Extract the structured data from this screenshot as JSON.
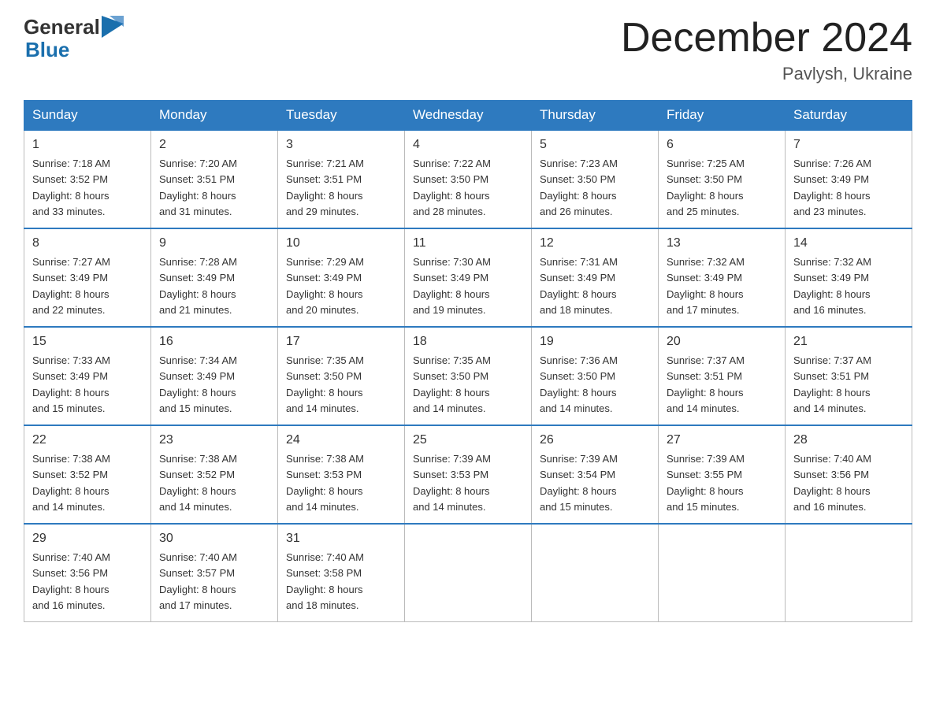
{
  "header": {
    "logo": {
      "general": "General",
      "blue": "Blue"
    },
    "title": "December 2024",
    "location": "Pavlysh, Ukraine"
  },
  "weekdays": [
    "Sunday",
    "Monday",
    "Tuesday",
    "Wednesday",
    "Thursday",
    "Friday",
    "Saturday"
  ],
  "weeks": [
    [
      {
        "day": "1",
        "sunrise": "7:18 AM",
        "sunset": "3:52 PM",
        "daylight": "8 hours and 33 minutes."
      },
      {
        "day": "2",
        "sunrise": "7:20 AM",
        "sunset": "3:51 PM",
        "daylight": "8 hours and 31 minutes."
      },
      {
        "day": "3",
        "sunrise": "7:21 AM",
        "sunset": "3:51 PM",
        "daylight": "8 hours and 29 minutes."
      },
      {
        "day": "4",
        "sunrise": "7:22 AM",
        "sunset": "3:50 PM",
        "daylight": "8 hours and 28 minutes."
      },
      {
        "day": "5",
        "sunrise": "7:23 AM",
        "sunset": "3:50 PM",
        "daylight": "8 hours and 26 minutes."
      },
      {
        "day": "6",
        "sunrise": "7:25 AM",
        "sunset": "3:50 PM",
        "daylight": "8 hours and 25 minutes."
      },
      {
        "day": "7",
        "sunrise": "7:26 AM",
        "sunset": "3:49 PM",
        "daylight": "8 hours and 23 minutes."
      }
    ],
    [
      {
        "day": "8",
        "sunrise": "7:27 AM",
        "sunset": "3:49 PM",
        "daylight": "8 hours and 22 minutes."
      },
      {
        "day": "9",
        "sunrise": "7:28 AM",
        "sunset": "3:49 PM",
        "daylight": "8 hours and 21 minutes."
      },
      {
        "day": "10",
        "sunrise": "7:29 AM",
        "sunset": "3:49 PM",
        "daylight": "8 hours and 20 minutes."
      },
      {
        "day": "11",
        "sunrise": "7:30 AM",
        "sunset": "3:49 PM",
        "daylight": "8 hours and 19 minutes."
      },
      {
        "day": "12",
        "sunrise": "7:31 AM",
        "sunset": "3:49 PM",
        "daylight": "8 hours and 18 minutes."
      },
      {
        "day": "13",
        "sunrise": "7:32 AM",
        "sunset": "3:49 PM",
        "daylight": "8 hours and 17 minutes."
      },
      {
        "day": "14",
        "sunrise": "7:32 AM",
        "sunset": "3:49 PM",
        "daylight": "8 hours and 16 minutes."
      }
    ],
    [
      {
        "day": "15",
        "sunrise": "7:33 AM",
        "sunset": "3:49 PM",
        "daylight": "8 hours and 15 minutes."
      },
      {
        "day": "16",
        "sunrise": "7:34 AM",
        "sunset": "3:49 PM",
        "daylight": "8 hours and 15 minutes."
      },
      {
        "day": "17",
        "sunrise": "7:35 AM",
        "sunset": "3:50 PM",
        "daylight": "8 hours and 14 minutes."
      },
      {
        "day": "18",
        "sunrise": "7:35 AM",
        "sunset": "3:50 PM",
        "daylight": "8 hours and 14 minutes."
      },
      {
        "day": "19",
        "sunrise": "7:36 AM",
        "sunset": "3:50 PM",
        "daylight": "8 hours and 14 minutes."
      },
      {
        "day": "20",
        "sunrise": "7:37 AM",
        "sunset": "3:51 PM",
        "daylight": "8 hours and 14 minutes."
      },
      {
        "day": "21",
        "sunrise": "7:37 AM",
        "sunset": "3:51 PM",
        "daylight": "8 hours and 14 minutes."
      }
    ],
    [
      {
        "day": "22",
        "sunrise": "7:38 AM",
        "sunset": "3:52 PM",
        "daylight": "8 hours and 14 minutes."
      },
      {
        "day": "23",
        "sunrise": "7:38 AM",
        "sunset": "3:52 PM",
        "daylight": "8 hours and 14 minutes."
      },
      {
        "day": "24",
        "sunrise": "7:38 AM",
        "sunset": "3:53 PM",
        "daylight": "8 hours and 14 minutes."
      },
      {
        "day": "25",
        "sunrise": "7:39 AM",
        "sunset": "3:53 PM",
        "daylight": "8 hours and 14 minutes."
      },
      {
        "day": "26",
        "sunrise": "7:39 AM",
        "sunset": "3:54 PM",
        "daylight": "8 hours and 15 minutes."
      },
      {
        "day": "27",
        "sunrise": "7:39 AM",
        "sunset": "3:55 PM",
        "daylight": "8 hours and 15 minutes."
      },
      {
        "day": "28",
        "sunrise": "7:40 AM",
        "sunset": "3:56 PM",
        "daylight": "8 hours and 16 minutes."
      }
    ],
    [
      {
        "day": "29",
        "sunrise": "7:40 AM",
        "sunset": "3:56 PM",
        "daylight": "8 hours and 16 minutes."
      },
      {
        "day": "30",
        "sunrise": "7:40 AM",
        "sunset": "3:57 PM",
        "daylight": "8 hours and 17 minutes."
      },
      {
        "day": "31",
        "sunrise": "7:40 AM",
        "sunset": "3:58 PM",
        "daylight": "8 hours and 18 minutes."
      },
      null,
      null,
      null,
      null
    ]
  ]
}
